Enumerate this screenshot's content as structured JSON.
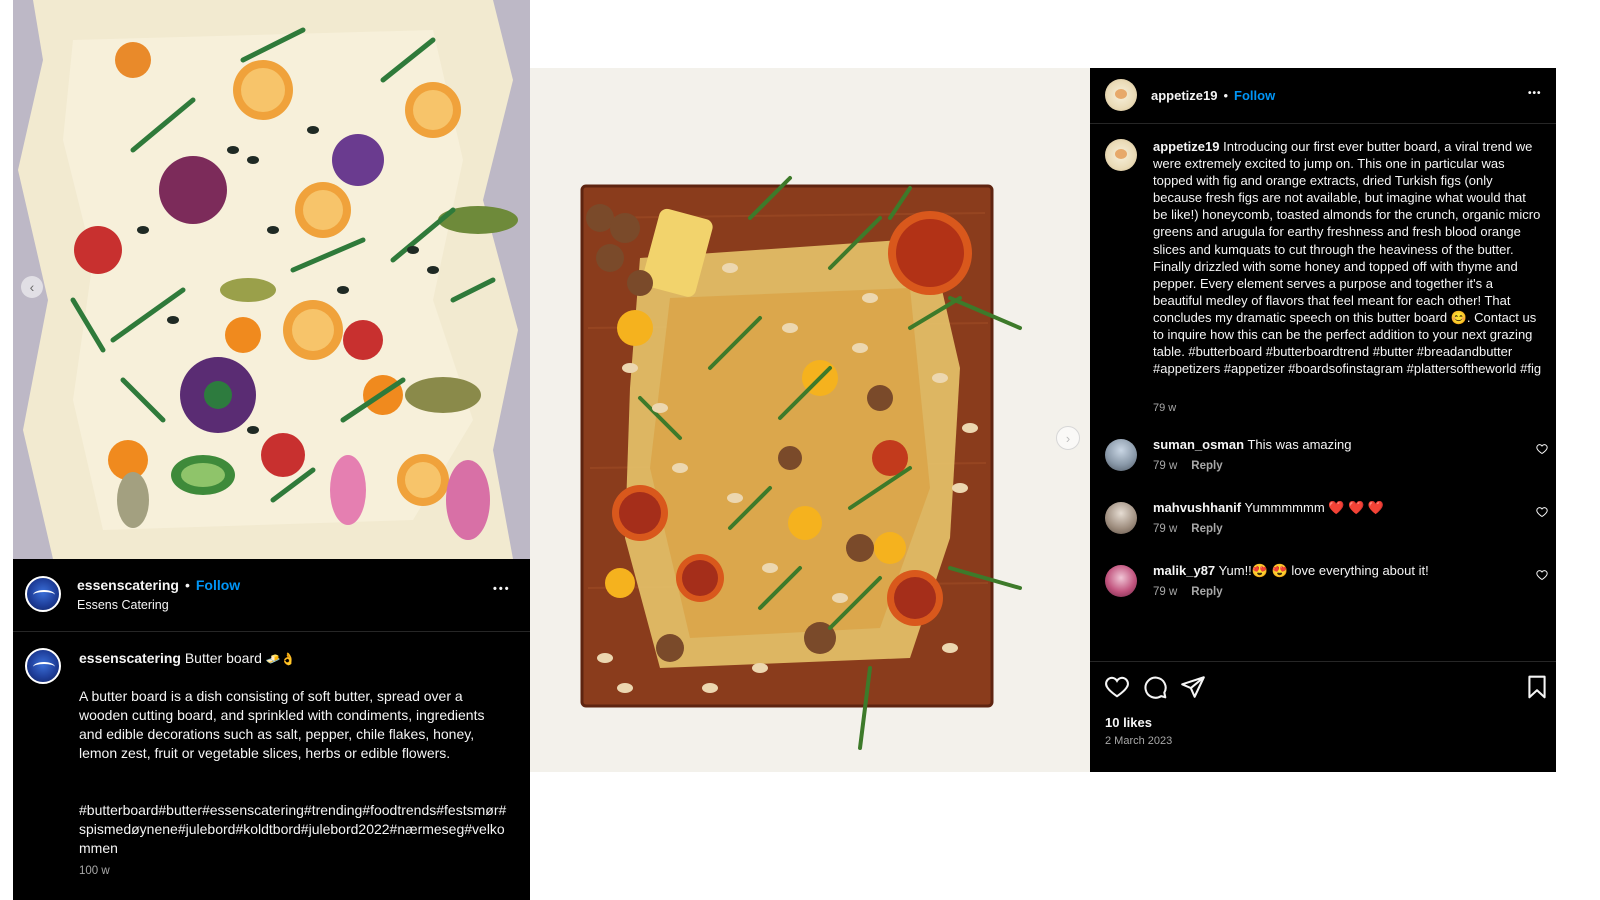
{
  "left_post": {
    "username": "essenscatering",
    "follow_label": "Follow",
    "separator": "•",
    "location": "Essens Catering",
    "more_label": "•••",
    "caption_username": "essenscatering",
    "caption_title": "Butter board",
    "caption_emoji": "🧈👌",
    "caption_body": "A butter board is a dish consisting of soft butter, spread over a wooden cutting board, and sprinkled with condiments, ingredients and edible decorations such as salt, pepper, chile flakes, honey, lemon zest, fruit or vegetable slices, herbs or edible flowers.",
    "hashtags": "#butterboard#butter#essenscatering#trending#foodtrends#festsmør#spismedøynene#julebord#koldtbord#julebord2022#nærmeseg#velkommen",
    "age": "100 w",
    "prev_arrow": "‹"
  },
  "middle": {
    "next_arrow": "›"
  },
  "right_post": {
    "username": "appetize19",
    "follow_label": "Follow",
    "separator": "•",
    "more_label": "•••",
    "caption_username": "appetize19",
    "caption": "Introducing our first ever butter board, a viral trend we were extremely excited to jump on. This one in particular was topped with fig and orange extracts, dried Turkish figs (only because fresh figs are not available, but imagine what would that be like!) honeycomb, toasted almonds for the crunch, organic micro greens and arugula for earthy freshness and fresh blood orange slices and kumquats to cut through the heaviness of the butter. Finally drizzled with some honey and topped off with thyme and pepper. Every element serves a purpose and together it's a beautiful medley of flavors that feel meant for each other! That concludes my dramatic speech on this butter board 😊. Contact us to inquire how this can be the perfect addition to your next grazing table. #butterboard #butterboardtrend #butter #breadandbutter #appetizers #appetizer #boardsofinstagram #plattersoftheworld #fig",
    "caption_age": "79 w",
    "comments": [
      {
        "username": "suman_osman",
        "text": "This was amazing",
        "age": "79 w",
        "reply": "Reply"
      },
      {
        "username": "mahvushhanif",
        "text": "Yummmmmm ❤️ ❤️ ❤️",
        "age": "79 w",
        "reply": "Reply"
      },
      {
        "username": "malik_y87",
        "text": "Yum!!😍 😍 love everything about it!",
        "age": "79 w",
        "reply": "Reply"
      }
    ],
    "likes": "10 likes",
    "date": "2 March 2023"
  },
  "icons": {
    "like": "heart-icon",
    "comment": "comment-icon",
    "share": "share-icon",
    "save": "bookmark-icon",
    "more": "more-options-icon",
    "comment_like": "heart-icon"
  },
  "colors": {
    "follow": "#0095f6",
    "panel_bg": "#000000",
    "text": "#f5f5f5",
    "muted": "#a8a8a8"
  }
}
